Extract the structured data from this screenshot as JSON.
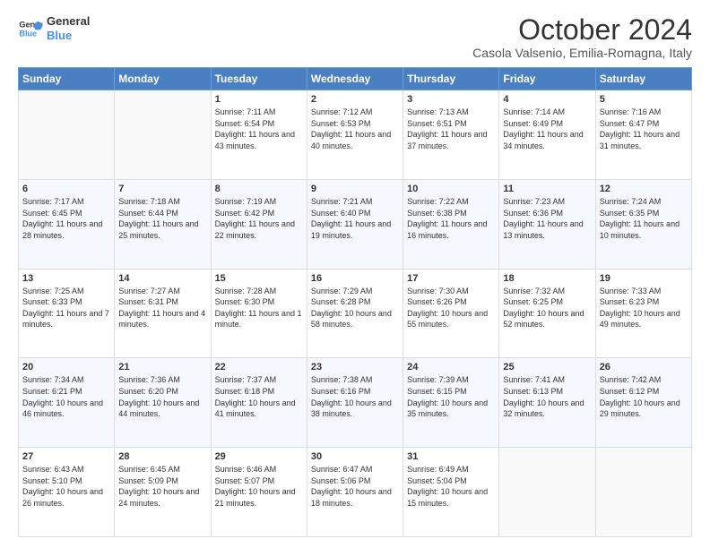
{
  "logo": {
    "line1": "General",
    "line2": "Blue"
  },
  "title": "October 2024",
  "subtitle": "Casola Valsenio, Emilia-Romagna, Italy",
  "headers": [
    "Sunday",
    "Monday",
    "Tuesday",
    "Wednesday",
    "Thursday",
    "Friday",
    "Saturday"
  ],
  "weeks": [
    [
      {
        "day": "",
        "sunrise": "",
        "sunset": "",
        "daylight": ""
      },
      {
        "day": "",
        "sunrise": "",
        "sunset": "",
        "daylight": ""
      },
      {
        "day": "1",
        "sunrise": "Sunrise: 7:11 AM",
        "sunset": "Sunset: 6:54 PM",
        "daylight": "Daylight: 11 hours and 43 minutes."
      },
      {
        "day": "2",
        "sunrise": "Sunrise: 7:12 AM",
        "sunset": "Sunset: 6:53 PM",
        "daylight": "Daylight: 11 hours and 40 minutes."
      },
      {
        "day": "3",
        "sunrise": "Sunrise: 7:13 AM",
        "sunset": "Sunset: 6:51 PM",
        "daylight": "Daylight: 11 hours and 37 minutes."
      },
      {
        "day": "4",
        "sunrise": "Sunrise: 7:14 AM",
        "sunset": "Sunset: 6:49 PM",
        "daylight": "Daylight: 11 hours and 34 minutes."
      },
      {
        "day": "5",
        "sunrise": "Sunrise: 7:16 AM",
        "sunset": "Sunset: 6:47 PM",
        "daylight": "Daylight: 11 hours and 31 minutes."
      }
    ],
    [
      {
        "day": "6",
        "sunrise": "Sunrise: 7:17 AM",
        "sunset": "Sunset: 6:45 PM",
        "daylight": "Daylight: 11 hours and 28 minutes."
      },
      {
        "day": "7",
        "sunrise": "Sunrise: 7:18 AM",
        "sunset": "Sunset: 6:44 PM",
        "daylight": "Daylight: 11 hours and 25 minutes."
      },
      {
        "day": "8",
        "sunrise": "Sunrise: 7:19 AM",
        "sunset": "Sunset: 6:42 PM",
        "daylight": "Daylight: 11 hours and 22 minutes."
      },
      {
        "day": "9",
        "sunrise": "Sunrise: 7:21 AM",
        "sunset": "Sunset: 6:40 PM",
        "daylight": "Daylight: 11 hours and 19 minutes."
      },
      {
        "day": "10",
        "sunrise": "Sunrise: 7:22 AM",
        "sunset": "Sunset: 6:38 PM",
        "daylight": "Daylight: 11 hours and 16 minutes."
      },
      {
        "day": "11",
        "sunrise": "Sunrise: 7:23 AM",
        "sunset": "Sunset: 6:36 PM",
        "daylight": "Daylight: 11 hours and 13 minutes."
      },
      {
        "day": "12",
        "sunrise": "Sunrise: 7:24 AM",
        "sunset": "Sunset: 6:35 PM",
        "daylight": "Daylight: 11 hours and 10 minutes."
      }
    ],
    [
      {
        "day": "13",
        "sunrise": "Sunrise: 7:25 AM",
        "sunset": "Sunset: 6:33 PM",
        "daylight": "Daylight: 11 hours and 7 minutes."
      },
      {
        "day": "14",
        "sunrise": "Sunrise: 7:27 AM",
        "sunset": "Sunset: 6:31 PM",
        "daylight": "Daylight: 11 hours and 4 minutes."
      },
      {
        "day": "15",
        "sunrise": "Sunrise: 7:28 AM",
        "sunset": "Sunset: 6:30 PM",
        "daylight": "Daylight: 11 hours and 1 minute."
      },
      {
        "day": "16",
        "sunrise": "Sunrise: 7:29 AM",
        "sunset": "Sunset: 6:28 PM",
        "daylight": "Daylight: 10 hours and 58 minutes."
      },
      {
        "day": "17",
        "sunrise": "Sunrise: 7:30 AM",
        "sunset": "Sunset: 6:26 PM",
        "daylight": "Daylight: 10 hours and 55 minutes."
      },
      {
        "day": "18",
        "sunrise": "Sunrise: 7:32 AM",
        "sunset": "Sunset: 6:25 PM",
        "daylight": "Daylight: 10 hours and 52 minutes."
      },
      {
        "day": "19",
        "sunrise": "Sunrise: 7:33 AM",
        "sunset": "Sunset: 6:23 PM",
        "daylight": "Daylight: 10 hours and 49 minutes."
      }
    ],
    [
      {
        "day": "20",
        "sunrise": "Sunrise: 7:34 AM",
        "sunset": "Sunset: 6:21 PM",
        "daylight": "Daylight: 10 hours and 46 minutes."
      },
      {
        "day": "21",
        "sunrise": "Sunrise: 7:36 AM",
        "sunset": "Sunset: 6:20 PM",
        "daylight": "Daylight: 10 hours and 44 minutes."
      },
      {
        "day": "22",
        "sunrise": "Sunrise: 7:37 AM",
        "sunset": "Sunset: 6:18 PM",
        "daylight": "Daylight: 10 hours and 41 minutes."
      },
      {
        "day": "23",
        "sunrise": "Sunrise: 7:38 AM",
        "sunset": "Sunset: 6:16 PM",
        "daylight": "Daylight: 10 hours and 38 minutes."
      },
      {
        "day": "24",
        "sunrise": "Sunrise: 7:39 AM",
        "sunset": "Sunset: 6:15 PM",
        "daylight": "Daylight: 10 hours and 35 minutes."
      },
      {
        "day": "25",
        "sunrise": "Sunrise: 7:41 AM",
        "sunset": "Sunset: 6:13 PM",
        "daylight": "Daylight: 10 hours and 32 minutes."
      },
      {
        "day": "26",
        "sunrise": "Sunrise: 7:42 AM",
        "sunset": "Sunset: 6:12 PM",
        "daylight": "Daylight: 10 hours and 29 minutes."
      }
    ],
    [
      {
        "day": "27",
        "sunrise": "Sunrise: 6:43 AM",
        "sunset": "Sunset: 5:10 PM",
        "daylight": "Daylight: 10 hours and 26 minutes."
      },
      {
        "day": "28",
        "sunrise": "Sunrise: 6:45 AM",
        "sunset": "Sunset: 5:09 PM",
        "daylight": "Daylight: 10 hours and 24 minutes."
      },
      {
        "day": "29",
        "sunrise": "Sunrise: 6:46 AM",
        "sunset": "Sunset: 5:07 PM",
        "daylight": "Daylight: 10 hours and 21 minutes."
      },
      {
        "day": "30",
        "sunrise": "Sunrise: 6:47 AM",
        "sunset": "Sunset: 5:06 PM",
        "daylight": "Daylight: 10 hours and 18 minutes."
      },
      {
        "day": "31",
        "sunrise": "Sunrise: 6:49 AM",
        "sunset": "Sunset: 5:04 PM",
        "daylight": "Daylight: 10 hours and 15 minutes."
      },
      {
        "day": "",
        "sunrise": "",
        "sunset": "",
        "daylight": ""
      },
      {
        "day": "",
        "sunrise": "",
        "sunset": "",
        "daylight": ""
      }
    ]
  ]
}
